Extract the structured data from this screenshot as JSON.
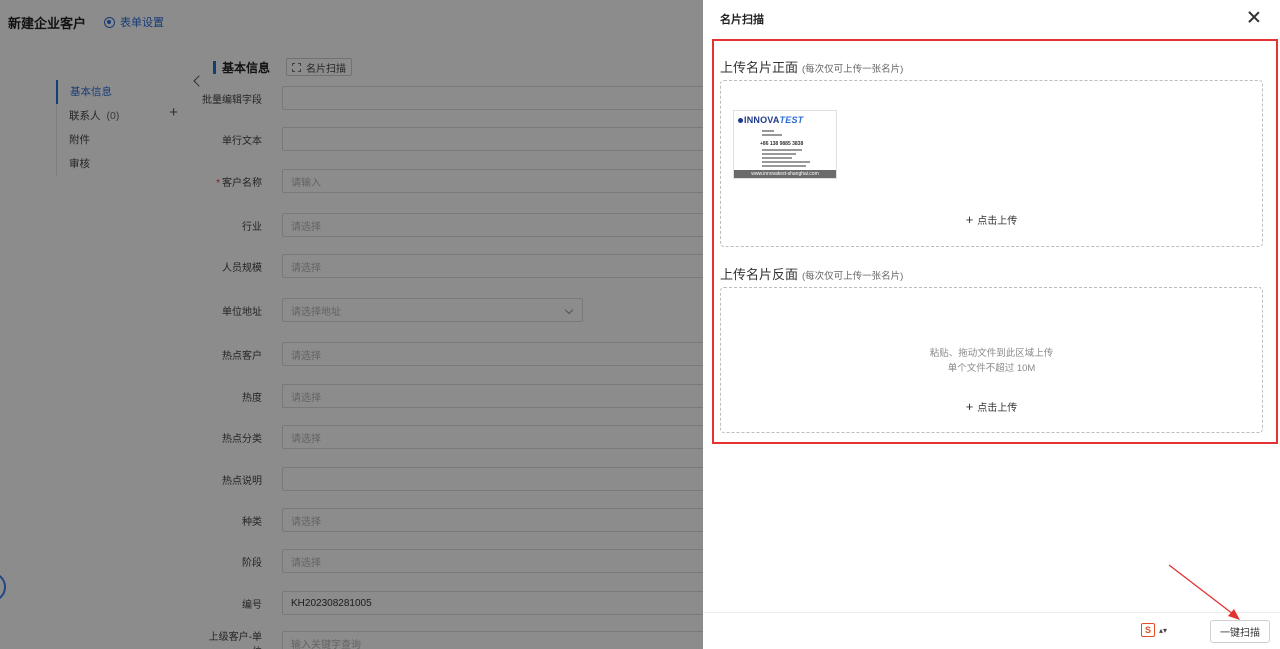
{
  "page": {
    "title": "新建企业客户",
    "form_settings_label": "表单设置",
    "nav": [
      {
        "label": "基本信息",
        "active": true
      },
      {
        "label": "联系人",
        "count": "(0)"
      },
      {
        "label": "附件"
      },
      {
        "label": "审核"
      }
    ],
    "section_title": "基本信息",
    "scan_button_label": "名片扫描",
    "fields": [
      {
        "label": "批量编辑字段",
        "value": ""
      },
      {
        "label": "单行文本",
        "value": ""
      },
      {
        "label": "客户名称",
        "placeholder": "请输入",
        "required": true
      },
      {
        "label": "行业",
        "placeholder": "请选择"
      },
      {
        "label": "人员规模",
        "placeholder": "请选择"
      },
      {
        "label": "单位地址",
        "placeholder": "请选择地址"
      },
      {
        "label": "热点客户",
        "placeholder": "请选择"
      },
      {
        "label": "热度",
        "placeholder": "请选择"
      },
      {
        "label": "热点分类",
        "placeholder": "请选择"
      },
      {
        "label": "热点说明",
        "value": ""
      },
      {
        "label": "种类",
        "placeholder": "请选择"
      },
      {
        "label": "阶段",
        "placeholder": "请选择"
      },
      {
        "label": "编号",
        "value": "KH202308281005"
      },
      {
        "label": "上级客户-单位",
        "placeholder": "输入关键字查询"
      }
    ]
  },
  "drawer": {
    "title": "名片扫描",
    "front": {
      "heading": "上传名片正面",
      "hint": "(每次仅可上传一张名片)",
      "upload_label": "点击上传",
      "card": {
        "logo_a": "INNOVA",
        "logo_b": "TEST",
        "phone": "+86 138 9885 3838",
        "website": "www.innovatest-shanghai.com"
      }
    },
    "back": {
      "heading": "上传名片反面",
      "hint": "(每次仅可上传一张名片)",
      "drop_line1": "粘贴、拖动文件到此区域上传",
      "drop_line2": "单个文件不超过 10M",
      "upload_label": "点击上传"
    },
    "footer": {
      "scan_button": "一键扫描",
      "ime_letter": "S"
    }
  },
  "colors": {
    "accent": "#2d6fd8",
    "highlight": "#e33232"
  }
}
